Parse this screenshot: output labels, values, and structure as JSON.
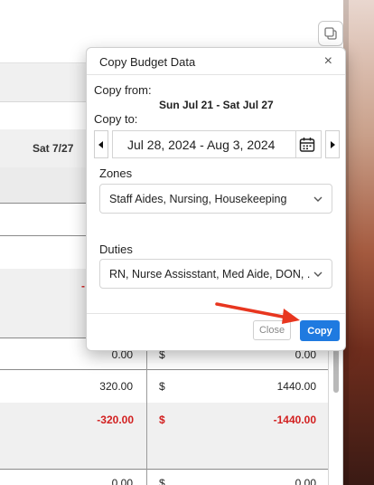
{
  "underlying": {
    "column_header": "Sat 7/27",
    "rows": [
      {
        "left_value": "0.00",
        "currency": "$",
        "right_value": "0.00",
        "negative": false
      },
      {
        "left_value": "320.00",
        "currency": "$",
        "right_value": "1440.00",
        "negative": false
      },
      {
        "left_value": "-320.00",
        "currency": "$",
        "right_value": "-1440.00",
        "negative": true
      },
      {
        "left_value": "0.00",
        "currency": "$",
        "right_value": "0.00",
        "negative": false
      }
    ],
    "partial_marker": "-",
    "copy_icon": "copy-icon"
  },
  "modal": {
    "title": "Copy Budget Data",
    "close_icon": "close-icon",
    "copy_from_label": "Copy from:",
    "copy_from_value": "Sun Jul 21 - Sat Jul 27",
    "copy_to_label": "Copy to:",
    "date_range": "Jul 28, 2024 - Aug 3, 2024",
    "prev_icon": "caret-left-icon",
    "next_icon": "caret-right-icon",
    "calendar_icon": "calendar-icon",
    "zones_label": "Zones",
    "zones_value": "Staff Aides, Nursing, Housekeeping",
    "duties_label": "Duties",
    "duties_value": "RN, Nurse Assisstant, Med Aide, DON, ...",
    "close_button": "Close",
    "copy_button": "Copy"
  },
  "colors": {
    "primary": "#1f7ae0",
    "negative": "#d21f1f",
    "annotation_arrow": "#e8361f"
  }
}
